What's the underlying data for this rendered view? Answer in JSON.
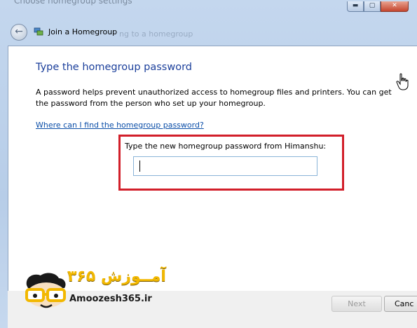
{
  "window": {
    "title": "Choose homegroup settings",
    "buttons": {
      "minimize": "▬",
      "maximize": "▢",
      "close": "✕"
    }
  },
  "nav": {
    "title": "Join a Homegroup",
    "ghost_text": "ng to a homegroup"
  },
  "page": {
    "heading": "Type the homegroup password",
    "description": "A password helps prevent unauthorized access to homegroup files and printers. You can get the password from the person who set up your homegroup.",
    "help_link": "Where can I find the homegroup password?",
    "password_label": "Type the new homegroup password from Himanshu:",
    "password_value": ""
  },
  "footer": {
    "next_label": "Next",
    "cancel_label": "Canc"
  },
  "watermark": {
    "brand_fa": "آمــوزش ۳۶۵",
    "brand_en": "Amoozesh365.ir"
  },
  "colors": {
    "heading": "#1b3f9b",
    "link": "#0b4ea8",
    "highlight_box": "#d21f2a"
  }
}
